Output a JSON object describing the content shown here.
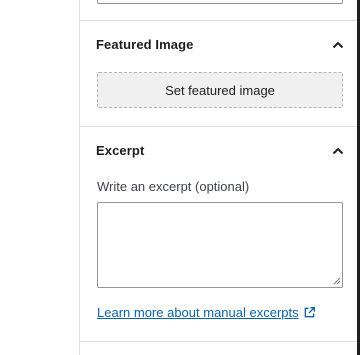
{
  "featured_image": {
    "title": "Featured Image",
    "toggle_icon": "chevron-up-icon",
    "button_label": "Set featured image"
  },
  "excerpt": {
    "title": "Excerpt",
    "toggle_icon": "chevron-up-icon",
    "field_label": "Write an excerpt (optional)",
    "value": "",
    "link_text": "Learn more about manual excerpts",
    "link_icon": "external-link-icon"
  },
  "colors": {
    "link": "#0a63a8",
    "border": "#949494",
    "divider": "#e0e0e0",
    "button_bg": "#f0f0f0"
  }
}
